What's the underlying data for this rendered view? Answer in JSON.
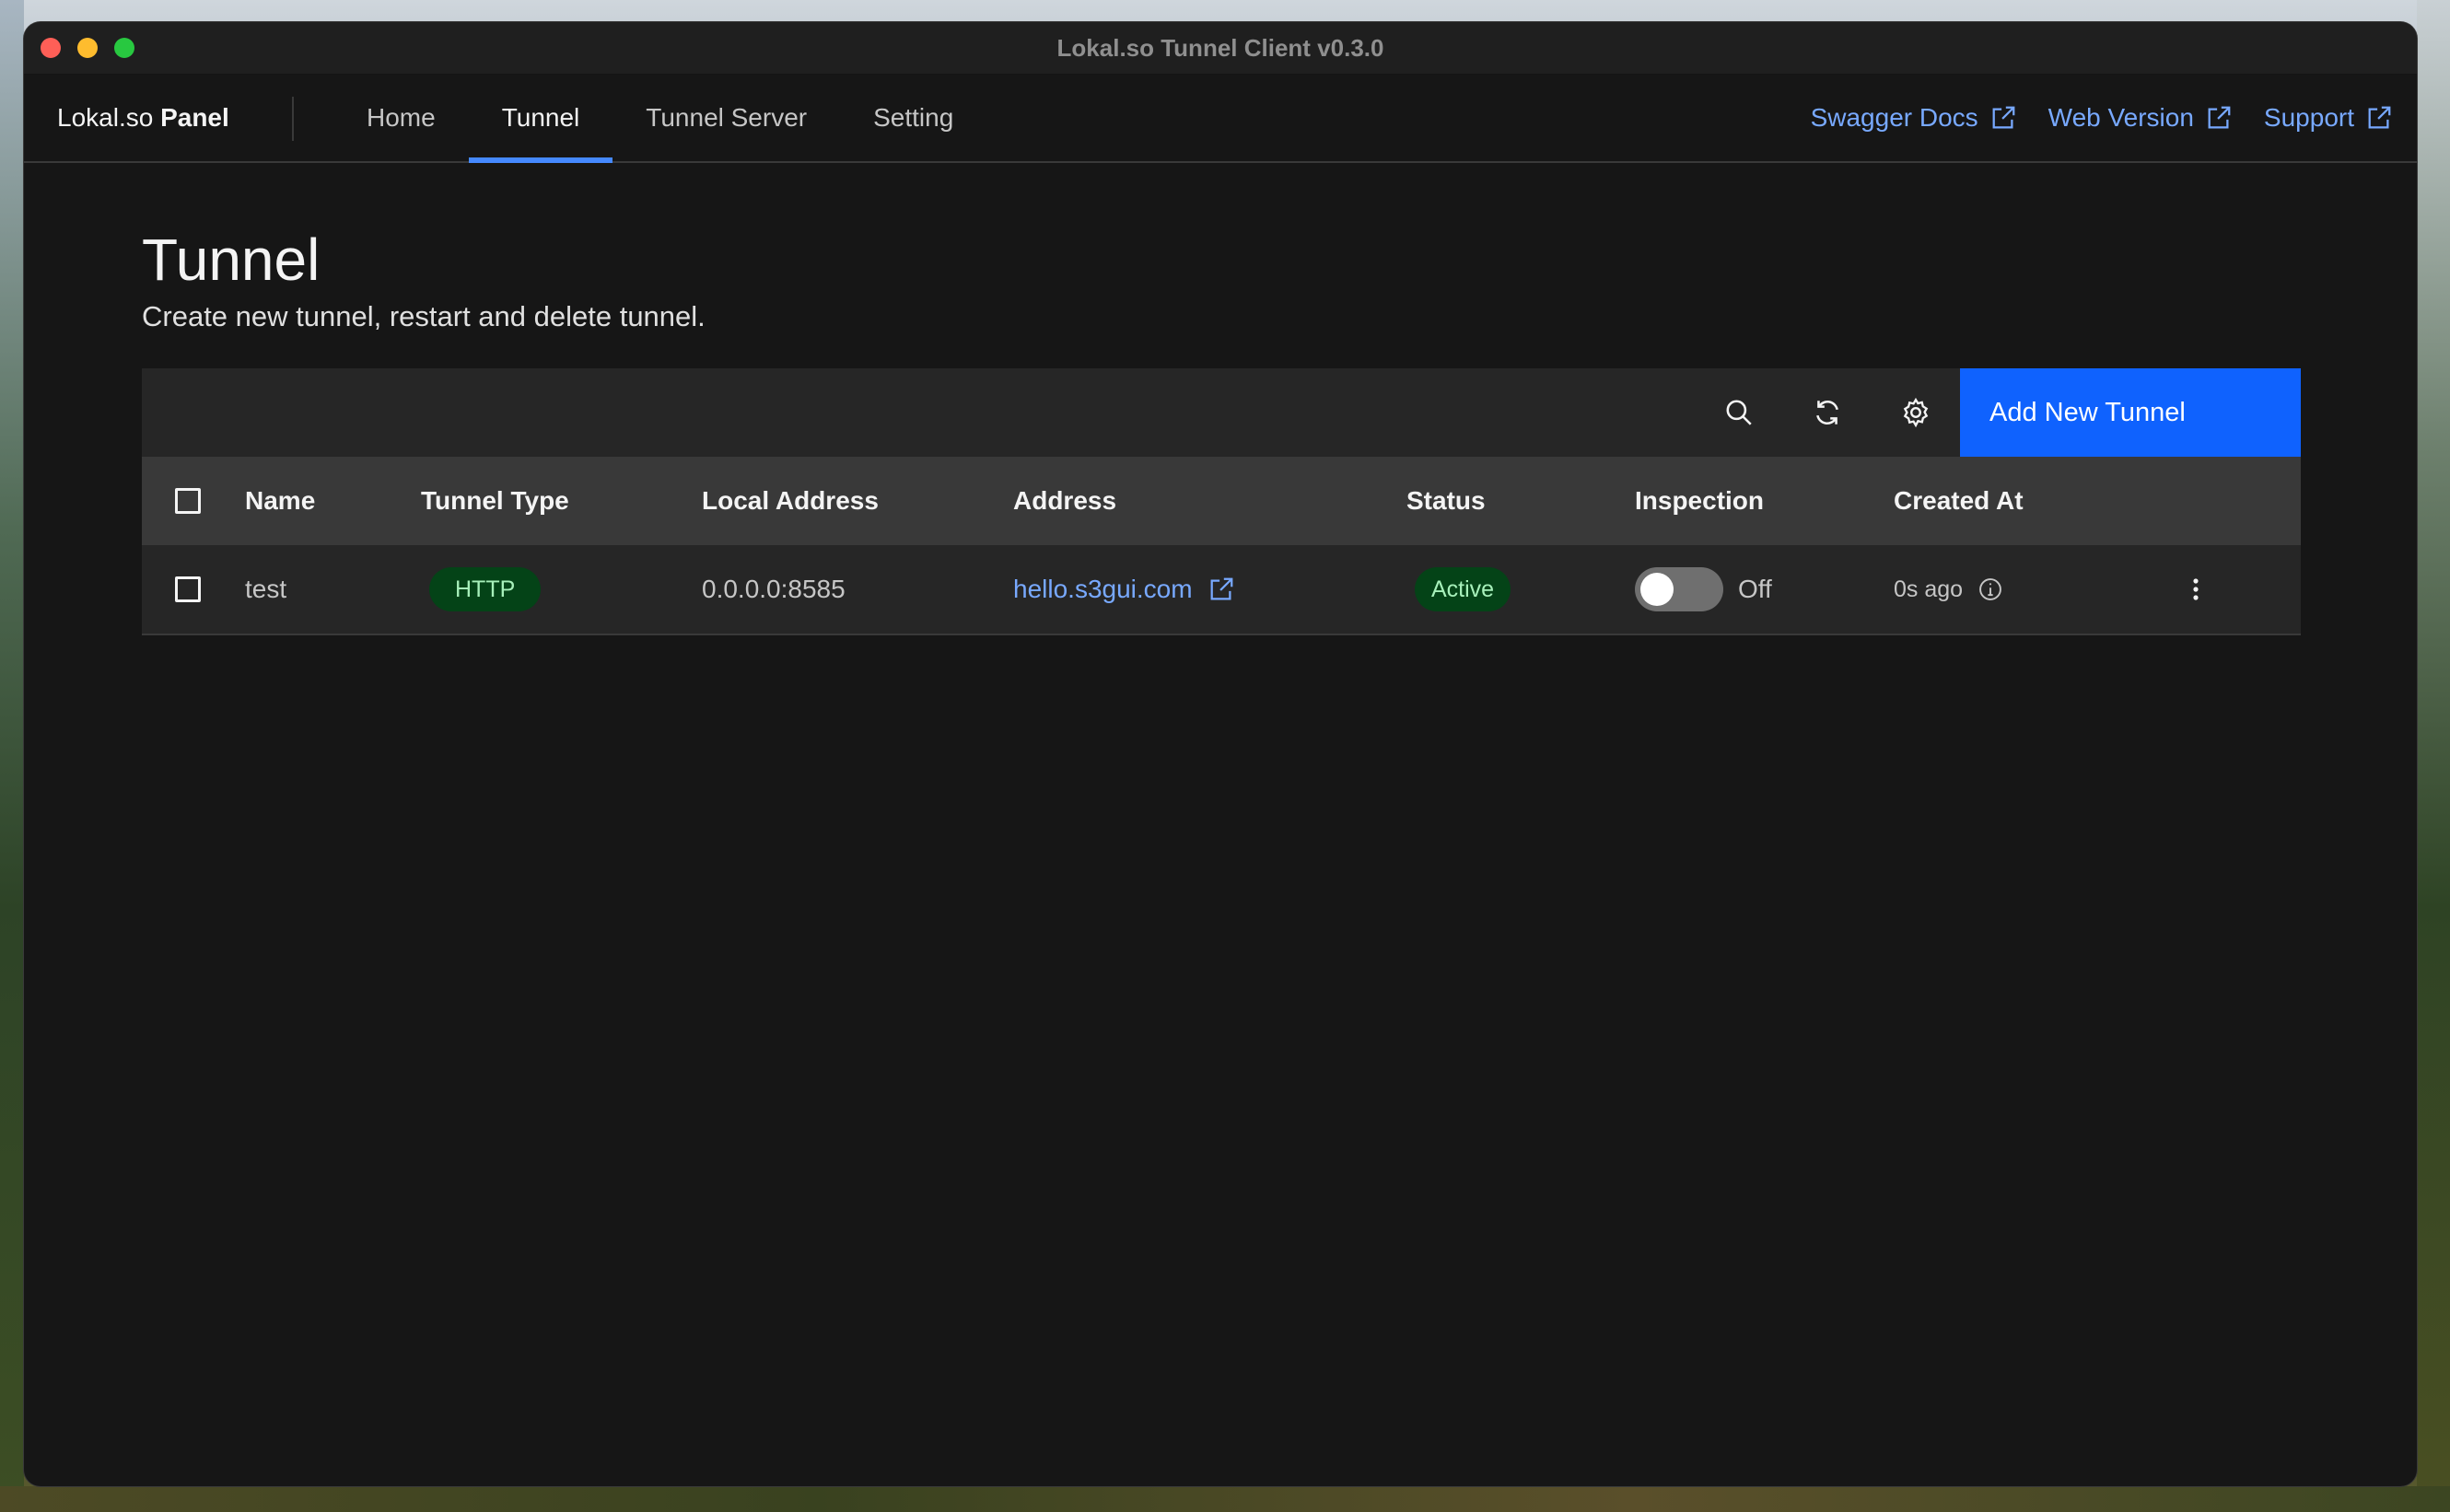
{
  "window": {
    "title": "Lokal.so Tunnel Client v0.3.0"
  },
  "brand": {
    "prefix": "Lokal.so",
    "bold": "Panel"
  },
  "nav": {
    "items": [
      {
        "label": "Home"
      },
      {
        "label": "Tunnel",
        "active": true
      },
      {
        "label": "Tunnel Server"
      },
      {
        "label": "Setting"
      }
    ]
  },
  "external_links": [
    {
      "label": "Swagger Docs",
      "icon": "external-link-icon"
    },
    {
      "label": "Web Version",
      "icon": "external-link-icon"
    },
    {
      "label": "Support",
      "icon": "external-link-icon"
    }
  ],
  "page": {
    "title": "Tunnel",
    "subtitle": "Create new tunnel, restart and delete tunnel."
  },
  "toolbar": {
    "icons": [
      "search-icon",
      "refresh-icon",
      "settings-icon"
    ],
    "add_label": "Add New Tunnel"
  },
  "table": {
    "headers": {
      "name": "Name",
      "tunnel_type": "Tunnel Type",
      "local_address": "Local Address",
      "address": "Address",
      "status": "Status",
      "inspection": "Inspection",
      "created_at": "Created At"
    },
    "rows": [
      {
        "name": "test",
        "tunnel_type": "HTTP",
        "local_address": "0.0.0.0:8585",
        "address": "hello.s3gui.com",
        "status": "Active",
        "inspection": "Off",
        "created_at": "0s ago"
      }
    ]
  },
  "colors": {
    "accent": "#0f62fe",
    "link": "#78a9ff",
    "tag_bg": "#044317",
    "tag_text": "#a7f0ba"
  }
}
